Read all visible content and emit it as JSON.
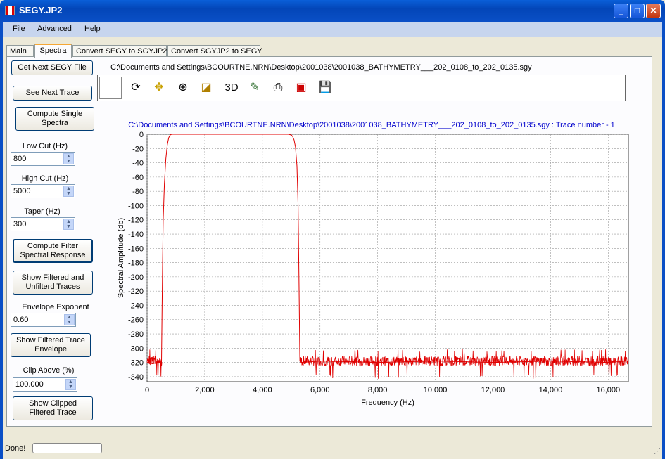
{
  "window": {
    "title": "SEGY.JP2"
  },
  "menu": [
    "File",
    "Advanced",
    "Help"
  ],
  "tabs": [
    "Main",
    "Spectra",
    "Convert SEGY to SGYJP2",
    "Convert SGYJP2 to SEGY"
  ],
  "left": {
    "get_next_file": "Get Next SEGY File",
    "see_next_trace": "See Next Trace",
    "compute_single_1": "Compute Single",
    "compute_single_2": "Spectra",
    "low_cut_label": "Low Cut (Hz)",
    "low_cut_value": "800",
    "high_cut_label": "High Cut (Hz)",
    "high_cut_value": "5000",
    "taper_label": "Taper (Hz)",
    "taper_value": "300",
    "compute_filter_1": "Compute Filter",
    "compute_filter_2": "Spectral Response",
    "show_filtered_1": "Show Filtered and",
    "show_filtered_2": "Unfilterd Traces",
    "envelope_label": "Envelope Exponent",
    "envelope_value": "0.60",
    "show_envelope_1": "Show Filtered Trace",
    "show_envelope_2": "Envelope",
    "clip_label": "Clip Above (%)",
    "clip_value": "100.000",
    "show_clipped_1": "Show Clipped",
    "show_clipped_2": "Filtered Trace"
  },
  "file_path": "C:\\Documents and Settings\\BCOURTNE.NRN\\Desktop\\2001038\\2001038_BATHYMETRY___202_0108_to_202_0135.sgy",
  "toolbar": {
    "three_d": "3D"
  },
  "status": {
    "text": "Done!"
  },
  "chart_data": {
    "type": "line",
    "title": "C:\\Documents  and  Settings\\BCOURTNE.NRN\\Desktop\\2001038\\2001038_BATHYMETRY___202_0108_to_202_0135.sgy  :  Trace  number  -  1",
    "xlabel": "Frequency (Hz)",
    "ylabel": "Spectral Amplitude (db)",
    "xlim": [
      0,
      16700
    ],
    "ylim": [
      -347,
      0
    ],
    "xticks": [
      0,
      2000,
      4000,
      6000,
      8000,
      10000,
      12000,
      14000,
      16000
    ],
    "xtick_labels": [
      "0",
      "2,000",
      "4,000",
      "6,000",
      "8,000",
      "10,000",
      "12,000",
      "14,000",
      "16,000"
    ],
    "yticks": [
      0,
      -20,
      -40,
      -60,
      -80,
      -100,
      -120,
      -140,
      -160,
      -180,
      -200,
      -220,
      -240,
      -260,
      -280,
      -300,
      -320,
      -340
    ],
    "grid": true,
    "color": "#e00000",
    "series": [
      {
        "x": [
          0,
          200,
          450,
          500,
          520,
          540,
          560,
          600,
          650,
          700,
          750,
          800,
          850,
          900,
          1000,
          3000,
          4800,
          4900,
          5000,
          5050,
          5100,
          5150,
          5200,
          5240,
          5270,
          5300,
          5350,
          6000,
          8000,
          10000,
          12000,
          14000,
          16000,
          16700
        ],
        "y": [
          -320,
          -322,
          -318,
          -320,
          -245,
          -175,
          -120,
          -70,
          -35,
          -15,
          -5,
          -1,
          0,
          0,
          0,
          0,
          0,
          0,
          -1,
          -3,
          -8,
          -18,
          -45,
          -100,
          -200,
          -318,
          -320,
          -318,
          -320,
          -318,
          -320,
          -318,
          -320,
          -318
        ]
      }
    ],
    "noise_band": {
      "from_hz": 5300,
      "to_hz": 16700,
      "level_db": -318,
      "range_db": [
        -343,
        -305
      ],
      "low_from_hz": 0,
      "low_to_hz": 520
    }
  }
}
